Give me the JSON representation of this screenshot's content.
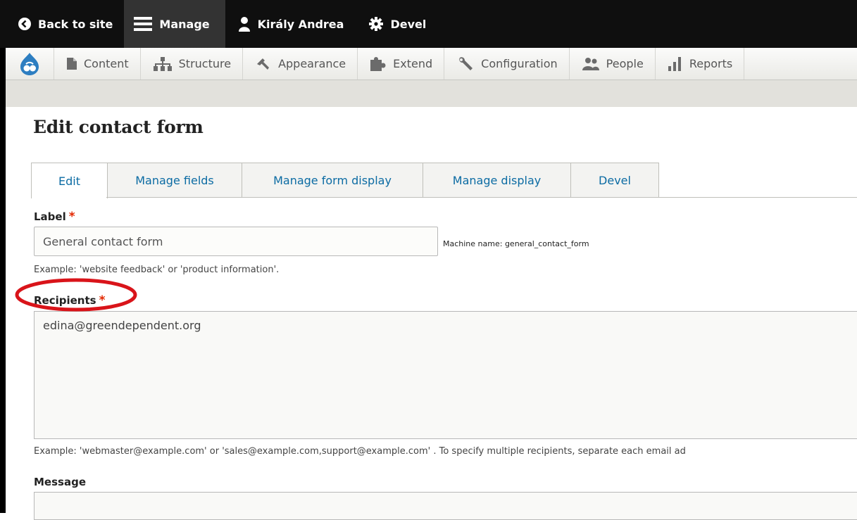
{
  "toolbar": {
    "back_label": "Back to site",
    "manage_label": "Manage",
    "user_label": "Király Andrea",
    "devel_label": "Devel"
  },
  "admin_menu": {
    "items": [
      {
        "label": "Content",
        "icon": "page-icon"
      },
      {
        "label": "Structure",
        "icon": "sitemap-icon"
      },
      {
        "label": "Appearance",
        "icon": "paint-icon"
      },
      {
        "label": "Extend",
        "icon": "puzzle-icon"
      },
      {
        "label": "Configuration",
        "icon": "wrench-icon"
      },
      {
        "label": "People",
        "icon": "people-icon"
      },
      {
        "label": "Reports",
        "icon": "bar-chart-icon"
      }
    ]
  },
  "page": {
    "title": "Edit contact form"
  },
  "tabs": [
    {
      "label": "Edit",
      "active": true
    },
    {
      "label": "Manage fields",
      "active": false
    },
    {
      "label": "Manage form display",
      "active": false
    },
    {
      "label": "Manage display",
      "active": false
    },
    {
      "label": "Devel",
      "active": false
    }
  ],
  "form": {
    "label_field": {
      "label": "Label",
      "required_mark": "*",
      "value": "General contact form",
      "machine_name": "Machine name: general_contact_form",
      "description": "Example: 'website feedback' or 'product information'."
    },
    "recipients_field": {
      "label": "Recipients",
      "required_mark": "*",
      "value": "edina@greendependent.org",
      "description": "Example: 'webmaster@example.com' or 'sales@example.com,support@example.com' . To specify multiple recipients, separate each email ad"
    },
    "message_field": {
      "label": "Message"
    }
  },
  "colors": {
    "toolbar_bg": "#0f0f0f",
    "link_blue": "#0b6ba3",
    "required_red": "#e32700",
    "annotation_red": "#d9141a"
  }
}
